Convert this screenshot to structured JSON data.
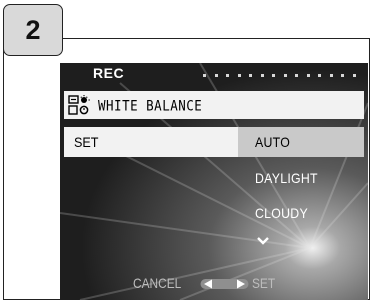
{
  "step": {
    "number": "2"
  },
  "screen": {
    "mode_label": "REC",
    "menu_title": "WHITE BALANCE",
    "menu_icon": "white-balance-icon",
    "left_item": {
      "label": "SET"
    },
    "options": [
      {
        "label": "AUTO",
        "selected": true
      },
      {
        "label": "DAYLIGHT",
        "selected": false
      },
      {
        "label": "CLOUDY",
        "selected": false
      }
    ],
    "more_indicator": "chevron-down-icon",
    "footer": {
      "cancel_label": "CANCEL",
      "set_label": "SET",
      "nav_icons": [
        "left-arrow-icon",
        "right-arrow-icon"
      ]
    }
  },
  "colors": {
    "highlight": "#c9c9c9",
    "bar_bg": "#f2f2f2",
    "screen_bg": "#2b2b2b",
    "badge_bg": "#d9d9d9"
  }
}
